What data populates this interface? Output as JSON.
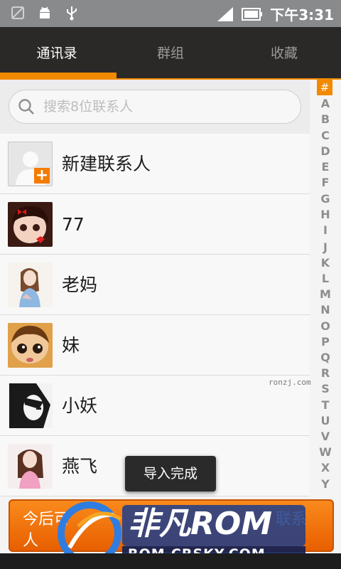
{
  "statusbar": {
    "time": "下午3:31"
  },
  "tabs": [
    {
      "label": "通讯录"
    },
    {
      "label": "群组"
    },
    {
      "label": "收藏"
    }
  ],
  "search": {
    "placeholder": "搜索8位联系人"
  },
  "contacts": [
    {
      "name": "新建联系人"
    },
    {
      "name": "77"
    },
    {
      "name": "老妈"
    },
    {
      "name": "妹"
    },
    {
      "name": "小妖"
    },
    {
      "name": "燕飞"
    }
  ],
  "index_letters": [
    "#",
    "A",
    "B",
    "C",
    "D",
    "E",
    "F",
    "G",
    "H",
    "I",
    "J",
    "K",
    "L",
    "M",
    "N",
    "O",
    "P",
    "Q",
    "R",
    "S",
    "T",
    "U",
    "V",
    "W",
    "X",
    "Y"
  ],
  "watermark_small": "ronzj.com",
  "toast": {
    "text": "导入完成"
  },
  "banner": {
    "line1": "今后可",
    "line2": "人",
    "line1_right": "联系"
  },
  "logo": {
    "brand": "非凡ROM",
    "url": "ROM.CRSKY.COM"
  },
  "colors": {
    "accent": "#f28a00",
    "tabbar": "#2b2927",
    "statusbar": "#888a8c"
  }
}
